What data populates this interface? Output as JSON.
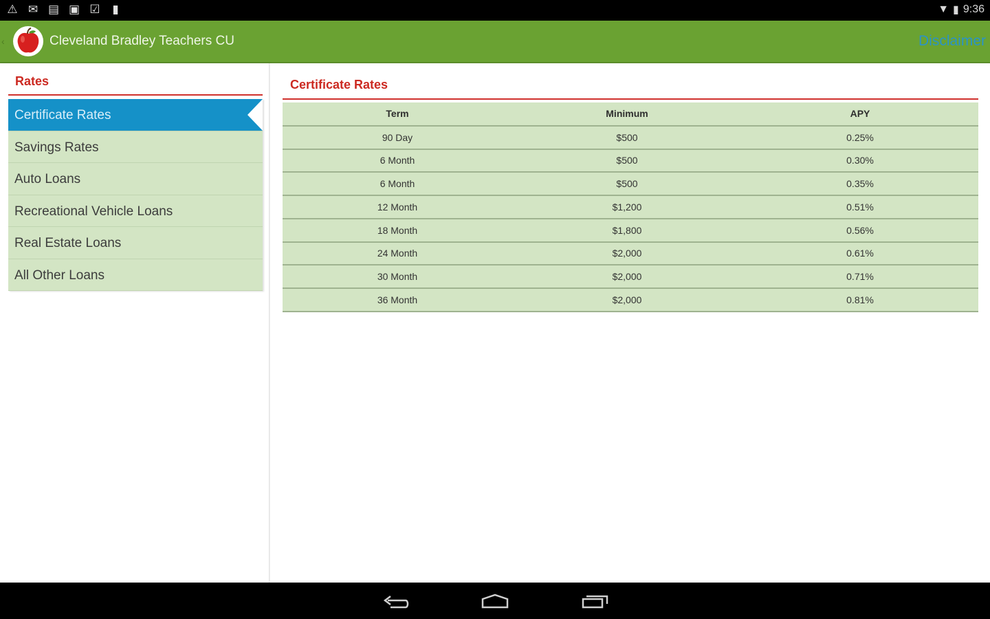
{
  "status_bar": {
    "time": "9:36",
    "left_icons": [
      "warning-icon",
      "mail-icon",
      "note-icon",
      "bag-icon",
      "check-bag-icon",
      "sd-card-icon"
    ]
  },
  "app_bar": {
    "title": "Cleveland Bradley Teachers CU",
    "disclaimer_label": "Disclaimer"
  },
  "sidebar": {
    "header": "Rates",
    "items": [
      {
        "label": "Certificate Rates",
        "active": true
      },
      {
        "label": "Savings Rates",
        "active": false
      },
      {
        "label": "Auto Loans",
        "active": false
      },
      {
        "label": "Recreational Vehicle Loans",
        "active": false
      },
      {
        "label": "Real Estate Loans",
        "active": false
      },
      {
        "label": "All Other Loans",
        "active": false
      }
    ]
  },
  "main": {
    "header": "Certificate Rates",
    "table": {
      "columns": [
        "Term",
        "Minimum",
        "APY"
      ],
      "rows": [
        [
          "90 Day",
          "$500",
          "0.25%"
        ],
        [
          "6 Month",
          "$500",
          "0.30%"
        ],
        [
          "6 Month",
          "$500",
          "0.35%"
        ],
        [
          "12 Month",
          "$1,200",
          "0.51%"
        ],
        [
          "18 Month",
          "$1,800",
          "0.56%"
        ],
        [
          "24 Month",
          "$2,000",
          "0.61%"
        ],
        [
          "30 Month",
          "$2,000",
          "0.71%"
        ],
        [
          "36 Month",
          "$2,000",
          "0.81%"
        ]
      ]
    }
  },
  "colors": {
    "app_bar": "#6aa232",
    "accent_red": "#cc2a22",
    "active_blue": "#1591c8",
    "row_green": "#d3e5c4",
    "disclaimer_blue": "#2a93c8"
  }
}
